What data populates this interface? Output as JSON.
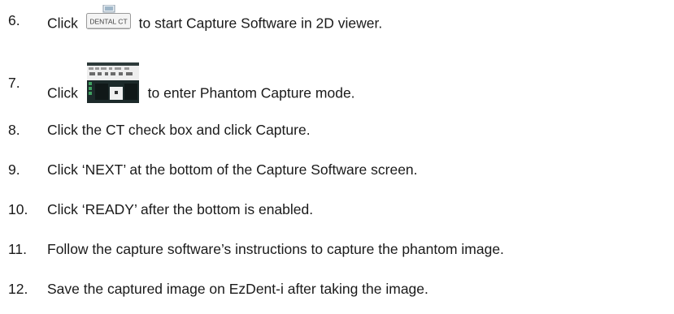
{
  "steps": [
    {
      "num": "6.",
      "before": "Click",
      "after": "to start Capture Software in 2D viewer.",
      "icon": "dental-ct-button-icon",
      "icon_text": "DENTAL CT"
    },
    {
      "num": "7.",
      "before": "Click",
      "after": "to enter Phantom Capture mode.",
      "icon": "phantom-capture-thumbnail-icon"
    },
    {
      "num": "8.",
      "text": "Click the CT check box and click Capture."
    },
    {
      "num": "9.",
      "text": "Click ‘NEXT’ at the bottom of the Capture Software screen."
    },
    {
      "num": "10.",
      "text": "Click ‘READY’ after the bottom is enabled."
    },
    {
      "num": "11.",
      "text": "Follow the capture software’s instructions to capture the phantom image."
    },
    {
      "num": "12.",
      "text": "Save the captured image on EzDent-i after taking the image."
    }
  ],
  "colors": {
    "text": "#1a1a1a",
    "icon_border": "#9a9a9a",
    "thumb_dark": "#1c2a2a",
    "thumb_accent": "#3fa060"
  }
}
